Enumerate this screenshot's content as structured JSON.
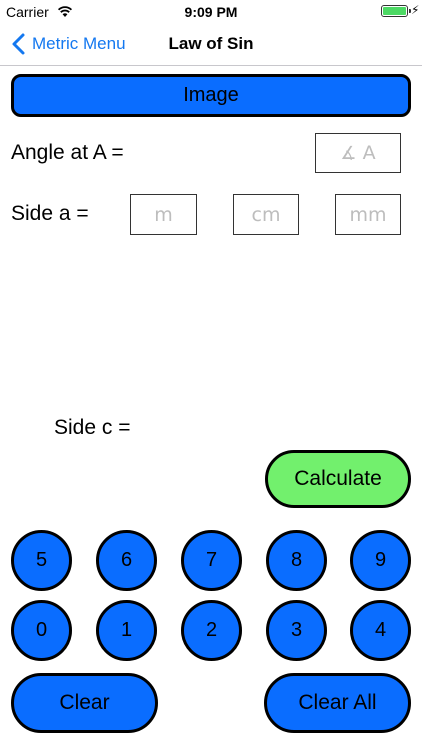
{
  "status_bar": {
    "carrier": "Carrier",
    "time": "9:09 PM",
    "wifi_icon": "wifi-icon",
    "battery_icon": "battery-icon",
    "battery_level": 1.0,
    "charging_icon": "bolt-icon"
  },
  "nav": {
    "back_label": "Metric Menu",
    "title": "Law of Sin",
    "back_icon": "chevron-left-icon"
  },
  "image_button_label": "Image",
  "angle_row": {
    "label": "Angle at A =",
    "placeholder": "A",
    "icon": "angle-icon"
  },
  "side_a_row": {
    "label": "Side a =",
    "placeholders": [
      "m",
      "cm",
      "mm"
    ]
  },
  "side_c_label": "Side c =",
  "calculate_label": "Calculate",
  "keypad": {
    "row1": [
      "5",
      "6",
      "7",
      "8",
      "9"
    ],
    "row2": [
      "0",
      "1",
      "2",
      "3",
      "4"
    ]
  },
  "clear_label": "Clear",
  "clear_all_label": "Clear All",
  "colors": {
    "accent_blue": "#0a6dff",
    "calculate_green": "#72f06d",
    "ios_link": "#1478f0"
  }
}
